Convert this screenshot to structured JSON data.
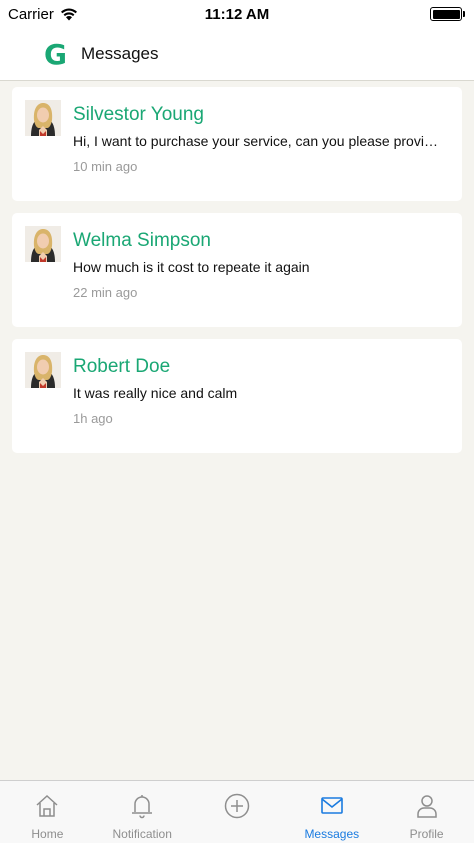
{
  "status": {
    "carrier": "Carrier",
    "time": "11:12 AM"
  },
  "header": {
    "logo": "G",
    "title": "Messages"
  },
  "messages": [
    {
      "name": "Silvestor Young",
      "text": "Hi, I want to purchase your service, can you please provide details",
      "time": "10 min ago"
    },
    {
      "name": "Welma Simpson",
      "text": "How much is it cost to repeate it again",
      "time": "22 min ago"
    },
    {
      "name": "Robert Doe",
      "text": "It was really nice and calm",
      "time": "1h ago"
    }
  ],
  "tabs": [
    {
      "label": "Home",
      "icon": "home-icon"
    },
    {
      "label": "Notification",
      "icon": "bell-icon"
    },
    {
      "label": "",
      "icon": "plus-circle-icon"
    },
    {
      "label": "Messages",
      "icon": "mail-icon",
      "active": true
    },
    {
      "label": "Profile",
      "icon": "person-icon"
    }
  ],
  "colors": {
    "accent_green": "#1aa774",
    "active_tab_blue": "#1a7be0",
    "background": "#f5f4ef"
  }
}
